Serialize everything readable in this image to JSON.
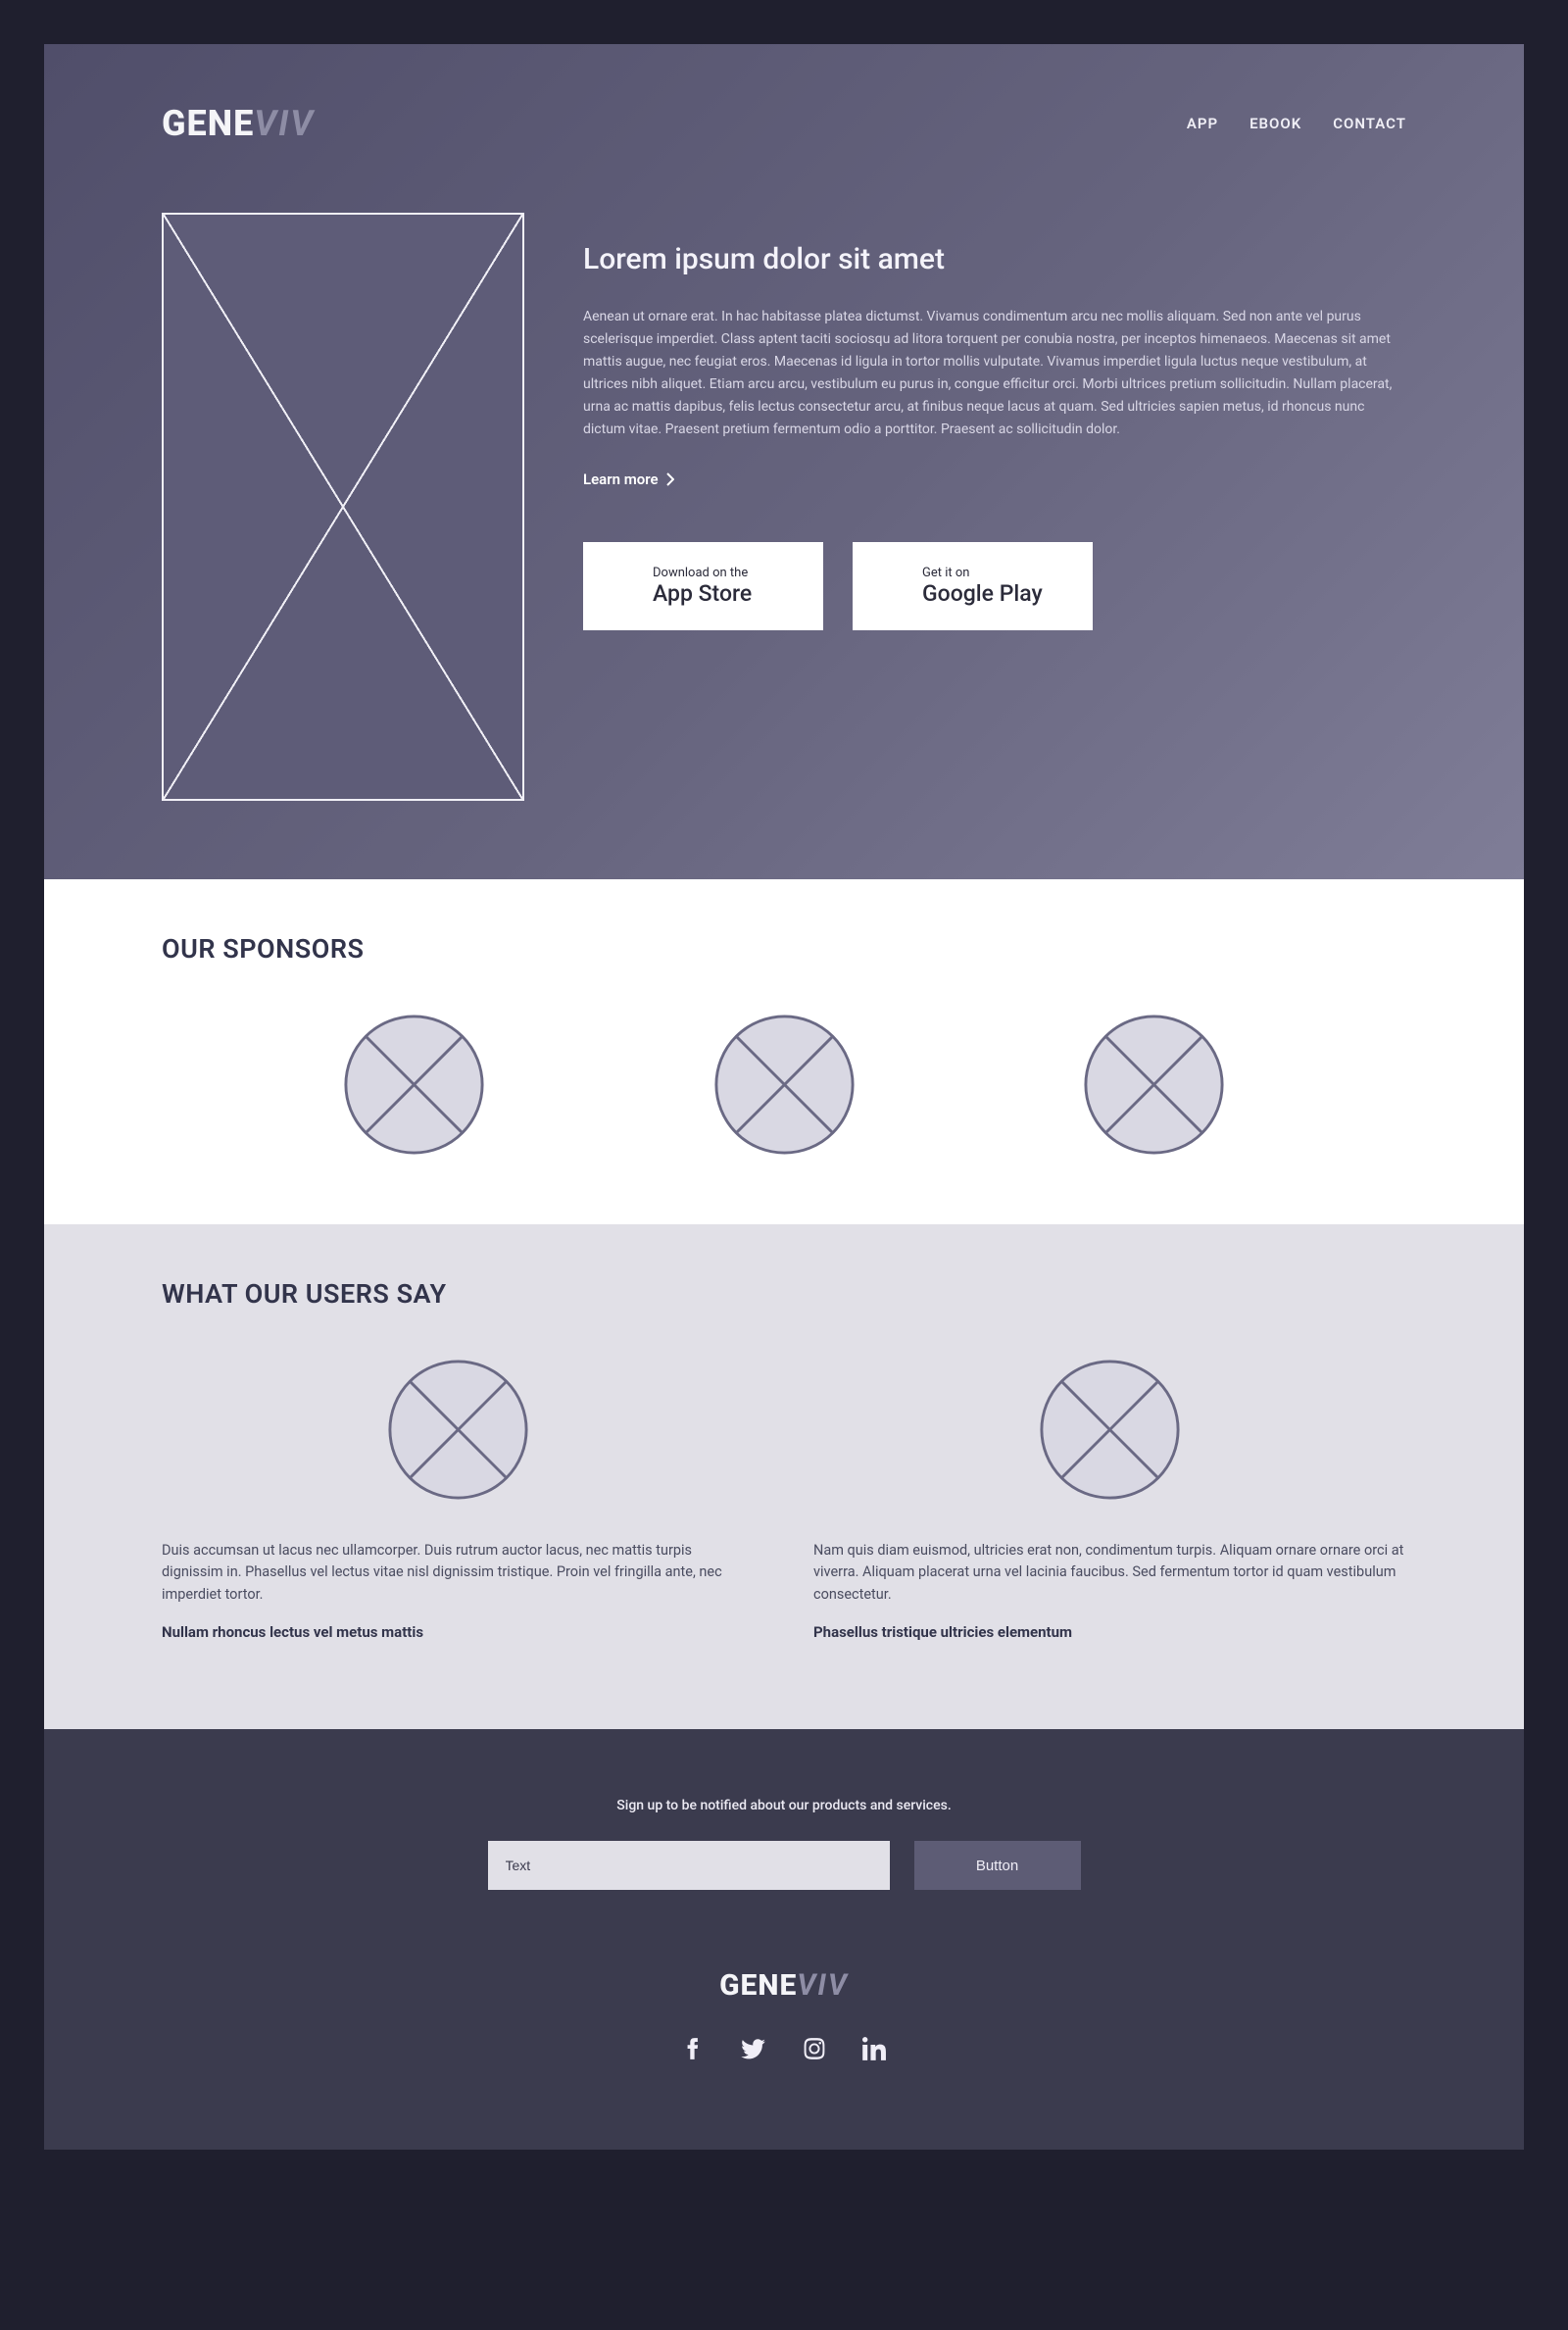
{
  "logo": {
    "part1": "GENE",
    "part2": "VIV"
  },
  "nav": {
    "app": "APP",
    "ebook": "EBOOK",
    "contact": "CONTACT"
  },
  "hero": {
    "heading": "Lorem ipsum dolor sit amet",
    "body": "Aenean ut ornare erat. In hac habitasse platea dictumst. Vivamus condimentum arcu nec mollis aliquam. Sed non ante vel purus scelerisque imperdiet. Class aptent taciti sociosqu ad litora torquent per conubia nostra, per inceptos himenaeos. Maecenas sit amet mattis augue, nec feugiat eros. Maecenas id ligula in tortor mollis vulputate. Vivamus imperdiet ligula luctus neque vestibulum, at ultrices nibh aliquet. Etiam arcu arcu, vestibulum eu purus in, congue efficitur orci. Morbi ultrices pretium sollicitudin. Nullam placerat, urna ac mattis dapibus, felis lectus consectetur arcu, at finibus neque lacus at quam. Sed ultricies sapien metus, id rhoncus nunc dictum vitae. Praesent pretium fermentum odio a porttitor. Praesent ac sollicitudin dolor.",
    "learn_more": "Learn more",
    "appstore": {
      "small": "Download on the",
      "big": "App Store"
    },
    "playstore": {
      "small": "Get it on",
      "big": "Google Play"
    }
  },
  "sponsors": {
    "title": "OUR SPONSORS"
  },
  "testimonials": {
    "title": "WHAT OUR USERS SAY",
    "items": [
      {
        "body": "Duis accumsan ut lacus nec ullamcorper. Duis rutrum auctor lacus, nec mattis turpis dignissim in. Phasellus vel lectus vitae nisl dignissim tristique. Proin vel fringilla ante, nec imperdiet tortor.",
        "name": "Nullam rhoncus lectus vel metus mattis"
      },
      {
        "body": "Nam quis diam euismod, ultricies erat non, condimentum turpis. Aliquam ornare ornare orci at viverra. Aliquam placerat urna vel lacinia faucibus. Sed fermentum tortor id quam vestibulum consectetur.",
        "name": "Phasellus tristique ultricies elementum"
      }
    ]
  },
  "footer": {
    "signup_text": "Sign up to be notified about our products and services.",
    "placeholder": "Text",
    "button": "Button"
  }
}
